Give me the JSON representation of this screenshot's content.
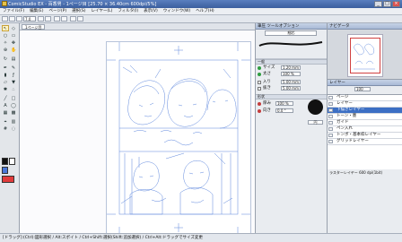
{
  "window": {
    "title": "ComicStudio EX - 百香男 - 1ページ目 [25.70 × 36.40cm 600dpi/5%]"
  },
  "menu": [
    "ファイル(F)",
    "編集(E)",
    "ページ(P)",
    "選択(S)",
    "レイヤー(L)",
    "フィルタ(I)",
    "表示(V)",
    "ウィンドウ(W)",
    "ヘルプ(H)"
  ],
  "toolbar": {
    "zoom": "7.0"
  },
  "document": {
    "tab_label": "1ページ目"
  },
  "tool_option": {
    "header": "筆圧  ツールオプション",
    "preset": "細芯",
    "general_label": "一般",
    "size_label": "サイズ",
    "size_value": "1.20 mm",
    "pressure_label": "太さ",
    "pressure_value": "100 %",
    "in_label": "入り",
    "in_value": "5.00 mm",
    "out_label": "抜き",
    "out_value": "5.00 mm",
    "shape_label": "形状",
    "thickness_label": "厚み",
    "thickness_value": "100 %",
    "angle_label": "向き",
    "angle_value": "0.0 °",
    "circle_label": "円"
  },
  "navigator": {
    "header": "ナビゲータ"
  },
  "layers": {
    "header": "レイヤー",
    "opacity": "100",
    "items": [
      {
        "name": "ページ",
        "selected": false
      },
      {
        "name": "レイヤー",
        "selected": false
      },
      {
        "name": "下描きレイヤー",
        "selected": true
      },
      {
        "name": "トーン・墨",
        "selected": false
      },
      {
        "name": "ガイド",
        "selected": false
      },
      {
        "name": "ペン入れ",
        "selected": false
      },
      {
        "name": "トンボ・基本枠レイヤー",
        "selected": false
      },
      {
        "name": "グリッドレイヤー",
        "selected": false
      }
    ],
    "footer": "ラスターレイヤー 600 dpi(1bit)"
  },
  "status": {
    "text": "[ドラッグ]:(Ctrl):図形選択 / Alt:スポイト / Ctrl+Shift:選択(Shift:追加選択) / Ctrl+Alt:ドラッグでサイズ変更"
  },
  "colors": {
    "accent": "#3c6fc4",
    "sketch": "#4a78d8",
    "titlebar": "#3b5f9e"
  }
}
